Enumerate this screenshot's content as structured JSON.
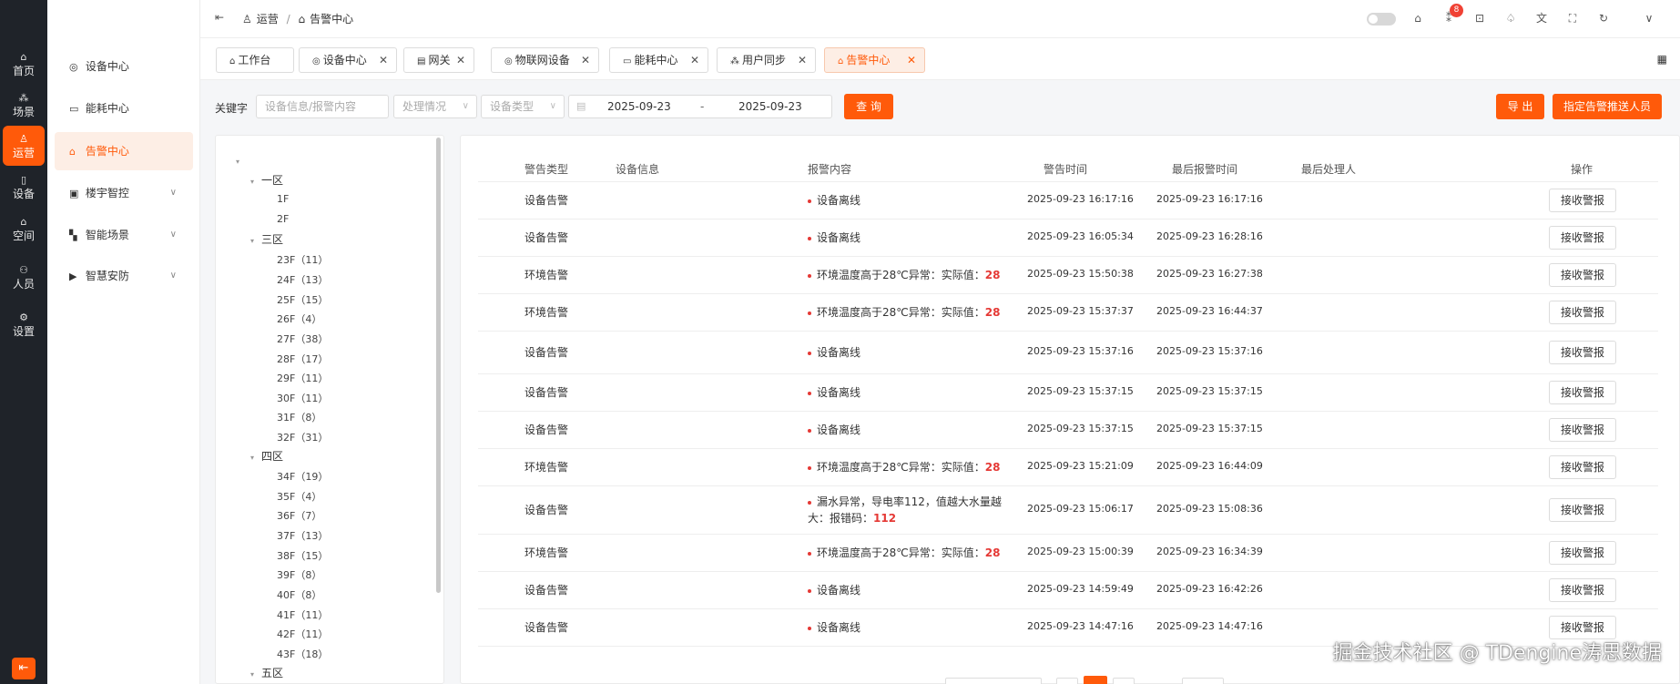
{
  "rail": [
    {
      "icon": "home-icon",
      "glyph": "⌂",
      "label": "首页"
    },
    {
      "icon": "scene-icon",
      "glyph": "⁂",
      "label": "场景"
    },
    {
      "icon": "user-icon",
      "glyph": "♙",
      "label": "运营"
    },
    {
      "icon": "device-icon",
      "glyph": "▯",
      "label": "设备"
    },
    {
      "icon": "space-icon",
      "glyph": "⌂",
      "label": "空间"
    },
    {
      "icon": "people-icon",
      "glyph": "⚇",
      "label": "人员"
    },
    {
      "icon": "settings-icon",
      "glyph": "⚙",
      "label": "设置"
    }
  ],
  "submenu": [
    {
      "icon": "device-center-icon",
      "glyph": "◎",
      "label": "设备中心"
    },
    {
      "icon": "energy-icon",
      "glyph": "▭",
      "label": "能耗中心"
    },
    {
      "icon": "alarm-icon",
      "glyph": "⌂",
      "label": "告警中心"
    },
    {
      "icon": "building-icon",
      "glyph": "▣",
      "label": "楼宇智控"
    },
    {
      "icon": "smart-scene-icon",
      "glyph": "▚",
      "label": "智能场景"
    },
    {
      "icon": "security-icon",
      "glyph": "▶",
      "label": "智慧安防"
    }
  ],
  "breadcrumb": {
    "first": "运营",
    "sep": "/",
    "second": "告警中心"
  },
  "header": {
    "notification_count": "8"
  },
  "tabs": [
    {
      "label": "工作台"
    },
    {
      "label": "设备中心"
    },
    {
      "label": "网关"
    },
    {
      "label": "物联网设备"
    },
    {
      "label": "能耗中心"
    },
    {
      "label": "用户同步"
    },
    {
      "label": "告警中心"
    }
  ],
  "filters": {
    "keyword_label": "关键字",
    "keyword_placeholder": "设备信息/报警内容",
    "status_placeholder": "处理情况",
    "type_placeholder": "设备类型",
    "date_start": "2025-09-23",
    "date_sep": "-",
    "date_end": "2025-09-23",
    "search_label": "查 询",
    "export_label": "导 出",
    "assign_label": "指定告警推送人员"
  },
  "tree": {
    "zones": [
      {
        "name": "一区",
        "floors": [
          "1F",
          "2F"
        ]
      },
      {
        "name": "三区",
        "floors": [
          "23F（11）",
          "24F（13）",
          "25F（15）",
          "26F（4）",
          "27F（38）",
          "28F（17）",
          "29F（11）",
          "30F（11）",
          "31F（8）",
          "32F（31）"
        ]
      },
      {
        "name": "四区",
        "floors": [
          "34F（19）",
          "35F（4）",
          "36F（7）",
          "37F（13）",
          "38F（15）",
          "39F（8）",
          "40F（8）",
          "41F（11）",
          "42F（11）",
          "43F（18）"
        ]
      },
      {
        "name": "五区",
        "floors": []
      }
    ]
  },
  "table": {
    "columns": [
      "警告类型",
      "设备信息",
      "报警内容",
      "警告时间",
      "最后报警时间",
      "最后处理人",
      "操作"
    ],
    "rows": [
      {
        "type": "设备告警",
        "content": "设备离线",
        "value": "",
        "t1": "2025-09-23 16:17:16",
        "t2": "2025-09-23 16:17:16"
      },
      {
        "type": "设备告警",
        "content": "设备离线",
        "value": "",
        "t1": "2025-09-23 16:05:34",
        "t2": "2025-09-23 16:28:16"
      },
      {
        "type": "环境告警",
        "content": "环境温度高于28℃异常：实际值：",
        "value": "28",
        "t1": "2025-09-23 15:50:38",
        "t2": "2025-09-23 16:27:38"
      },
      {
        "type": "环境告警",
        "content": "环境温度高于28℃异常：实际值：",
        "value": "28",
        "t1": "2025-09-23 15:37:37",
        "t2": "2025-09-23 16:44:37"
      },
      {
        "type": "设备告警",
        "content": "设备离线",
        "value": "",
        "t1": "2025-09-23 15:37:16",
        "t2": "2025-09-23 15:37:16"
      },
      {
        "type": "设备告警",
        "content": "设备离线",
        "value": "",
        "t1": "2025-09-23 15:37:15",
        "t2": "2025-09-23 15:37:15"
      },
      {
        "type": "设备告警",
        "content": "设备离线",
        "value": "",
        "t1": "2025-09-23 15:37:15",
        "t2": "2025-09-23 15:37:15"
      },
      {
        "type": "环境告警",
        "content": "环境温度高于28℃异常：实际值：",
        "value": "28",
        "t1": "2025-09-23 15:21:09",
        "t2": "2025-09-23 16:44:09"
      },
      {
        "type": "设备告警",
        "content": "漏水异常，导电率112，值越大水量越大：报错码：",
        "value": "112",
        "t1": "2025-09-23 15:06:17",
        "t2": "2025-09-23 15:08:36"
      },
      {
        "type": "环境告警",
        "content": "环境温度高于28℃异常：实际值：",
        "value": "28",
        "t1": "2025-09-23 15:00:39",
        "t2": "2025-09-23 16:34:39"
      },
      {
        "type": "设备告警",
        "content": "设备离线",
        "value": "",
        "t1": "2025-09-23 14:59:49",
        "t2": "2025-09-23 16:42:26"
      },
      {
        "type": "设备告警",
        "content": "设备离线",
        "value": "",
        "t1": "2025-09-23 14:47:16",
        "t2": "2025-09-23 14:47:16"
      }
    ],
    "action_label": "接收警报"
  },
  "watermark": "掘金技术社区 @ TDengine涛思数据",
  "colors": {
    "accent": "#ff5a0a",
    "rail_bg": "#1f2329",
    "alert_red": "#e53935"
  }
}
